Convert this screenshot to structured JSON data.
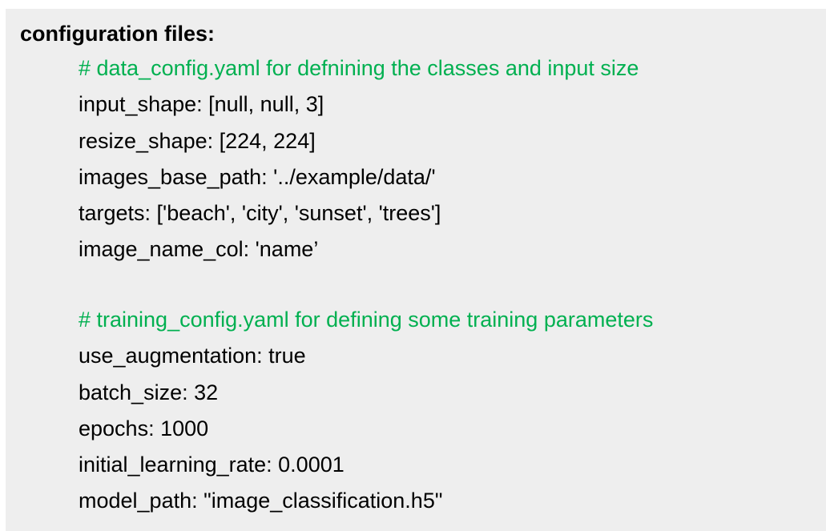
{
  "heading": "configuration files:",
  "colors": {
    "background": "#eeeeee",
    "text": "#000000",
    "comment": "#00b050"
  },
  "data_config": {
    "comment": "# data_config.yaml for defnining the classes and input size",
    "lines": [
      "input_shape: [null, null, 3]",
      "resize_shape: [224, 224]",
      "images_base_path: '../example/data/'",
      "targets: ['beach', 'city', 'sunset', 'trees']",
      "image_name_col: 'name’"
    ]
  },
  "training_config": {
    "comment": "# training_config.yaml for defining some training parameters",
    "lines": [
      "use_augmentation: true",
      "batch_size: 32",
      "epochs: 1000",
      "initial_learning_rate: 0.0001",
      "model_path: \"image_classification.h5\""
    ]
  }
}
